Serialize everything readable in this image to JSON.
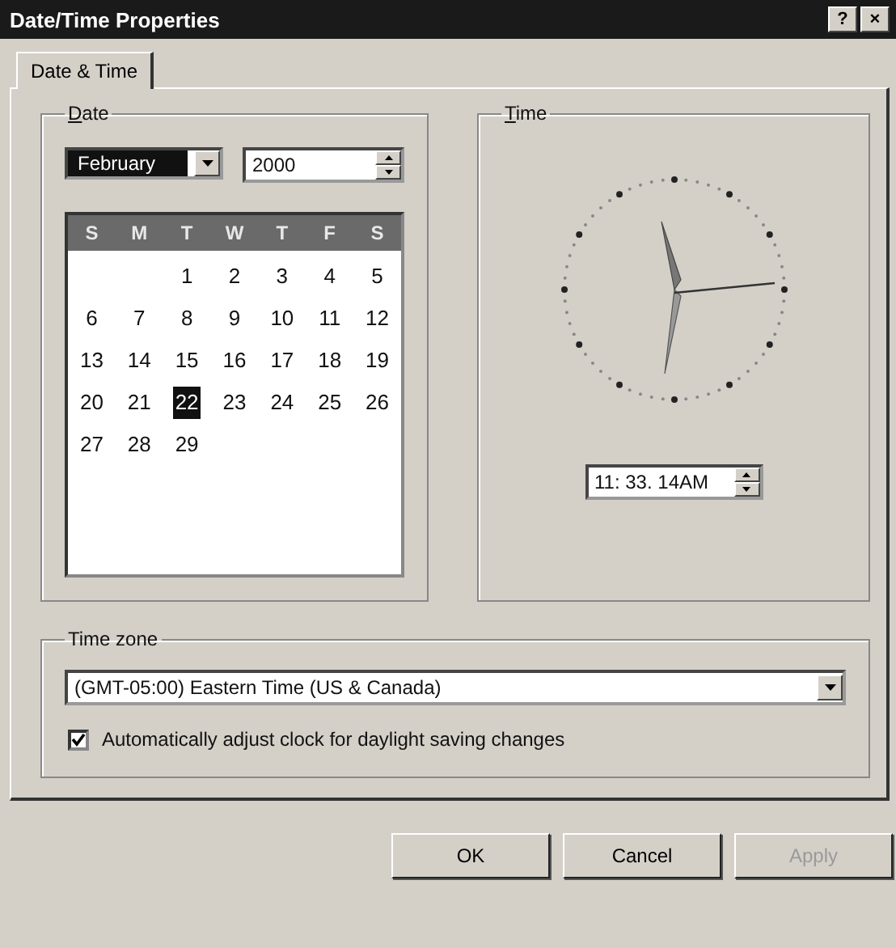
{
  "window": {
    "title": "Date/Time Properties",
    "title_buttons": [
      "?",
      "×"
    ]
  },
  "tabs": [
    {
      "label": "Date & Time",
      "selected": true
    }
  ],
  "date": {
    "label": "Date",
    "month": "February",
    "year": "2000",
    "weekdays": [
      "S",
      "M",
      "T",
      "W",
      "T",
      "F",
      "S"
    ],
    "weeks": [
      [
        {
          "day": "1",
          "selected": false
        },
        {
          "day": "2",
          "selected": false
        },
        {
          "day": "3",
          "selected": false
        },
        {
          "day": "4",
          "selected": false
        },
        {
          "day": "5",
          "selected": false
        }
      ],
      [
        {
          "day": "6",
          "selected": false
        },
        {
          "day": "7",
          "selected": false
        },
        {
          "day": "8",
          "selected": false
        },
        {
          "day": "9",
          "selected": false
        },
        {
          "day": "10",
          "selected": false
        },
        {
          "day": "11",
          "selected": false
        },
        {
          "day": "12",
          "selected": false
        }
      ],
      [
        {
          "day": "13",
          "selected": false
        },
        {
          "day": "14",
          "selected": false
        },
        {
          "day": "15",
          "selected": false
        },
        {
          "day": "16",
          "selected": false
        },
        {
          "day": "17",
          "selected": false
        },
        {
          "day": "18",
          "selected": false
        },
        {
          "day": "19",
          "selected": false
        }
      ],
      [
        {
          "day": "20",
          "selected": false
        },
        {
          "day": "21",
          "selected": false
        },
        {
          "day": "22",
          "selected": true
        },
        {
          "day": "23",
          "selected": false
        },
        {
          "day": "24",
          "selected": false
        },
        {
          "day": "25",
          "selected": false
        },
        {
          "day": "26",
          "selected": false
        }
      ],
      [
        {
          "day": "27",
          "selected": false
        },
        {
          "day": "28",
          "selected": false
        },
        {
          "day": "29",
          "selected": false
        }
      ]
    ]
  },
  "time": {
    "label": "Time",
    "value": "11: 33. 14AM"
  },
  "time_zone": {
    "label": "Time zone",
    "value": "(GMT-05:00) Eastern Time (US & Canada)",
    "daylight_checkbox": {
      "label": "Automatically adjust clock for daylight saving changes",
      "checked": true
    }
  },
  "buttons": [
    {
      "label": "OK",
      "disabled": false
    },
    {
      "label": "Cancel",
      "disabled": false
    },
    {
      "label": "Apply",
      "disabled": true
    }
  ]
}
